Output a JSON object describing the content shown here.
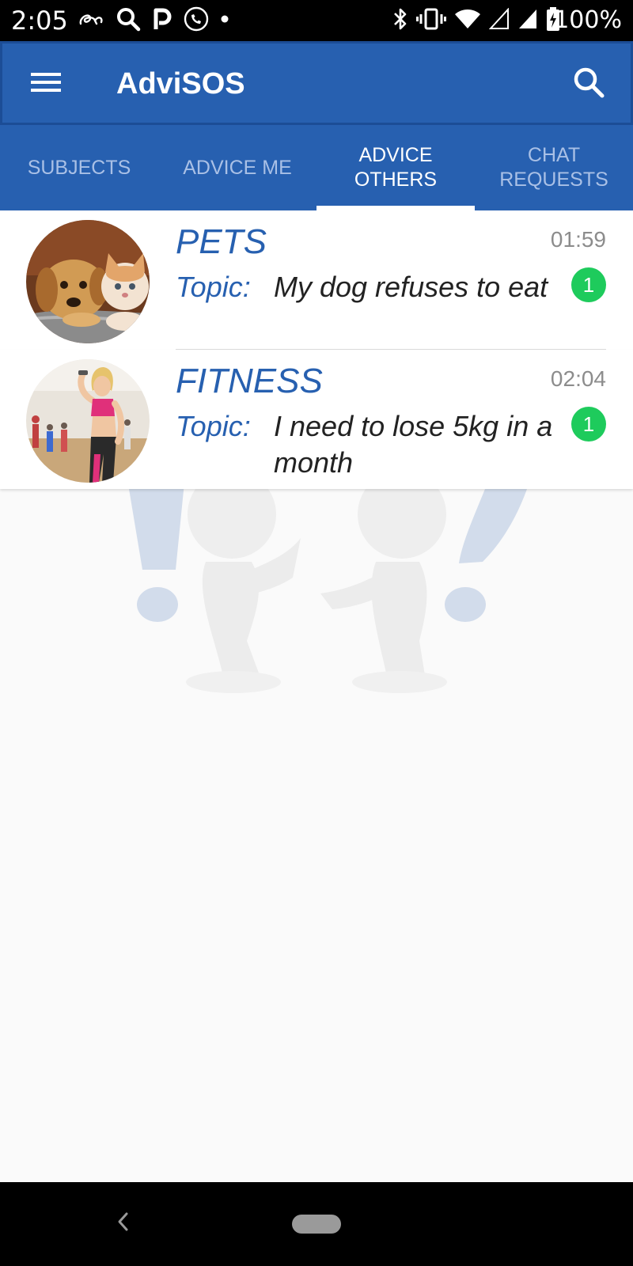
{
  "status_bar": {
    "time": "2:05",
    "battery_text": "100%",
    "left_icons": [
      "cursive-a-icon",
      "search-icon",
      "parking-icon",
      "phone-icon",
      "dot-icon"
    ],
    "right_icons": [
      "bluetooth-icon",
      "vibrate-icon",
      "wifi-icon",
      "signal-empty-icon",
      "signal-icon",
      "battery-charging-icon"
    ]
  },
  "app_bar": {
    "title": "AdviSOS",
    "menu_icon": "hamburger-menu-icon",
    "search_icon": "search-icon"
  },
  "tabs": [
    {
      "label": "SUBJECTS",
      "active": false
    },
    {
      "label": "ADVICE ME",
      "active": false
    },
    {
      "label": "ADVICE OTHERS",
      "active": true
    },
    {
      "label": "CHAT REQUESTS",
      "active": false
    }
  ],
  "chats": [
    {
      "subject": "PETS",
      "time": "01:59",
      "topic_label": "Topic:",
      "topic": "My dog refuses to eat",
      "unread": "1"
    },
    {
      "subject": "FITNESS",
      "time": "02:04",
      "topic_label": "Topic:",
      "topic": "I need to lose 5kg in a month",
      "unread": "1"
    }
  ],
  "colors": {
    "primary": "#2760b0",
    "badge": "#1ecb5c",
    "inactive_tab": "#a9c0e6",
    "background": "#fafafa"
  },
  "nav_bar": {
    "back_icon": "back-chevron-icon",
    "home_icon": "home-pill-icon"
  }
}
